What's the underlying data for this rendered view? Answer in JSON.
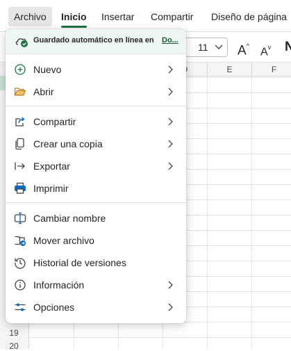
{
  "ribbon": {
    "tabs": [
      "Archivo",
      "Inicio",
      "Insertar",
      "Compartir",
      "Diseño de página"
    ]
  },
  "toolbar": {
    "font_size": "11",
    "grow_font": "A",
    "shrink_font": "A",
    "partial_button": "N"
  },
  "sheet": {
    "columns": [
      "D",
      "E",
      "F"
    ],
    "rows": [
      "19",
      "20"
    ]
  },
  "menu": {
    "status_text": "Guardado automático en línea en",
    "status_link": "Do...",
    "items": [
      {
        "label": "Nuevo",
        "icon": "plus-circle-icon",
        "submenu": true
      },
      {
        "label": "Abrir",
        "icon": "folder-open-icon",
        "submenu": true
      },
      {
        "label": "Compartir",
        "icon": "share-icon",
        "submenu": true
      },
      {
        "label": "Crear una copia",
        "icon": "copy-icon",
        "submenu": true
      },
      {
        "label": "Exportar",
        "icon": "export-icon",
        "submenu": true
      },
      {
        "label": "Imprimir",
        "icon": "printer-icon",
        "submenu": false
      },
      {
        "label": "Cambiar nombre",
        "icon": "rename-icon",
        "submenu": false
      },
      {
        "label": "Mover archivo",
        "icon": "move-folder-icon",
        "submenu": false
      },
      {
        "label": "Historial de versiones",
        "icon": "history-icon",
        "submenu": false
      },
      {
        "label": "Información",
        "icon": "info-icon",
        "submenu": true
      },
      {
        "label": "Opciones",
        "icon": "settings-sliders-icon",
        "submenu": true
      }
    ]
  },
  "colors": {
    "accent_green": "#1e7145",
    "link_green": "#185c37",
    "menu_icon_blue": "#0f6cbd",
    "folder_orange": "#e8a33b",
    "selected_row": "#c8e3d3"
  }
}
